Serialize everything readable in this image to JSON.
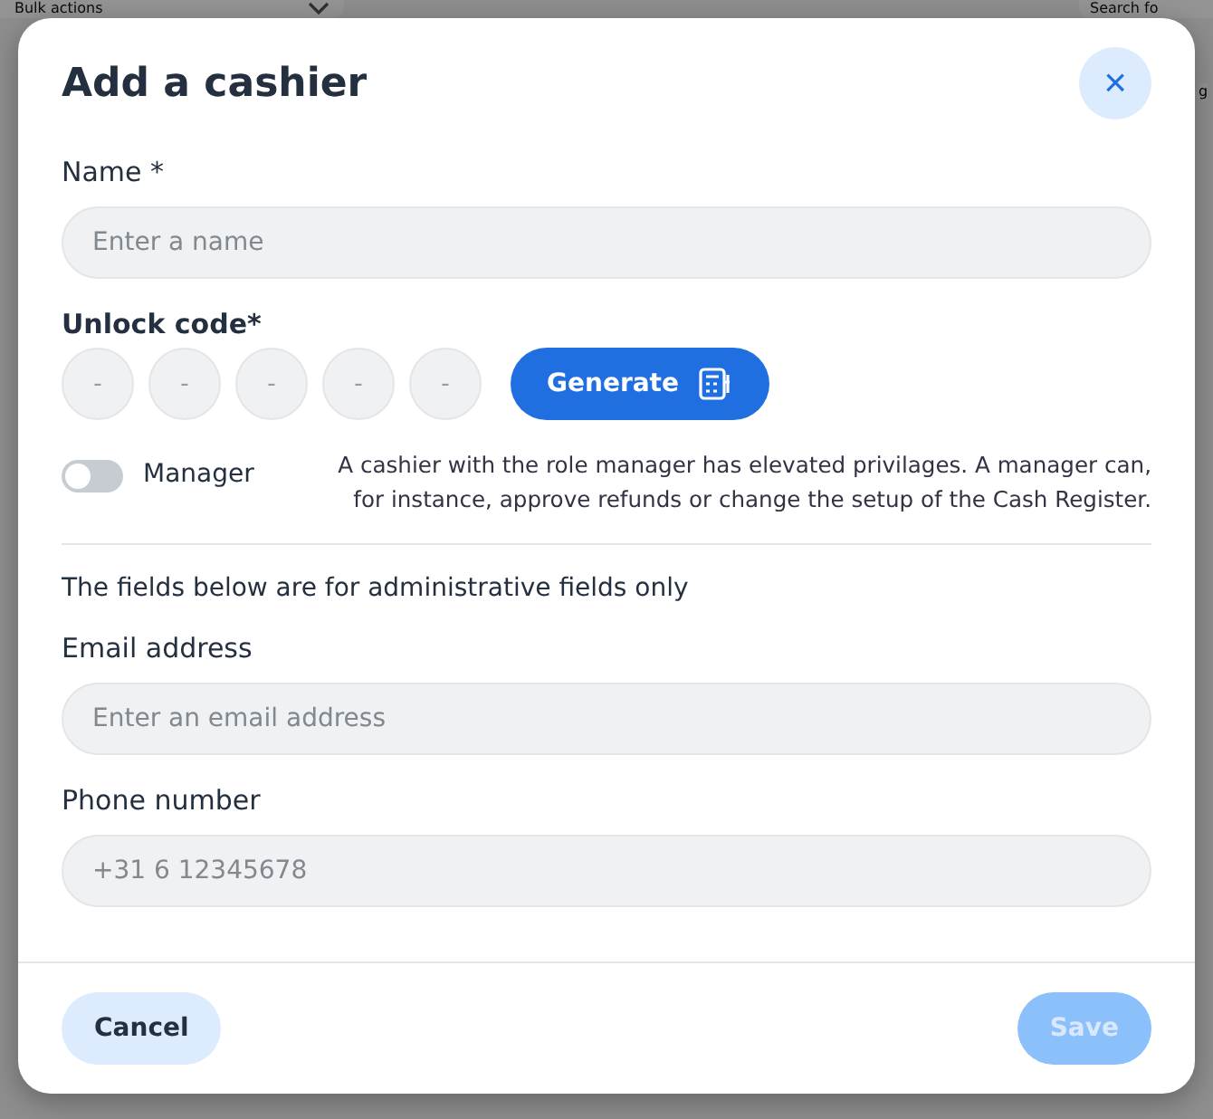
{
  "background": {
    "bulk_actions": "Bulk actions",
    "search": "Search fo",
    "column_fragment": "g"
  },
  "dialog": {
    "title": "Add a cashier",
    "close": "×"
  },
  "name": {
    "label": "Name *",
    "placeholder": "Enter a name"
  },
  "unlock_code": {
    "label": "Unlock code*",
    "digits": [
      {
        "placeholder": "-"
      },
      {
        "placeholder": "-"
      },
      {
        "placeholder": "-"
      },
      {
        "placeholder": "-"
      },
      {
        "placeholder": "-"
      }
    ],
    "generate": "Generate"
  },
  "manager": {
    "label": "Manager",
    "on": false,
    "description": "A cashier with the role manager has elevated privilages. A manager can, for instance, approve refunds or change the setup of the Cash Register."
  },
  "admin_note": "The fields below are for administrative fields only",
  "email": {
    "label": "Email address",
    "placeholder": "Enter an email address"
  },
  "phone": {
    "label": "Phone number",
    "placeholder": "+31 6 12345678"
  },
  "footer": {
    "cancel": "Cancel",
    "save": "Save",
    "save_disabled": true
  }
}
